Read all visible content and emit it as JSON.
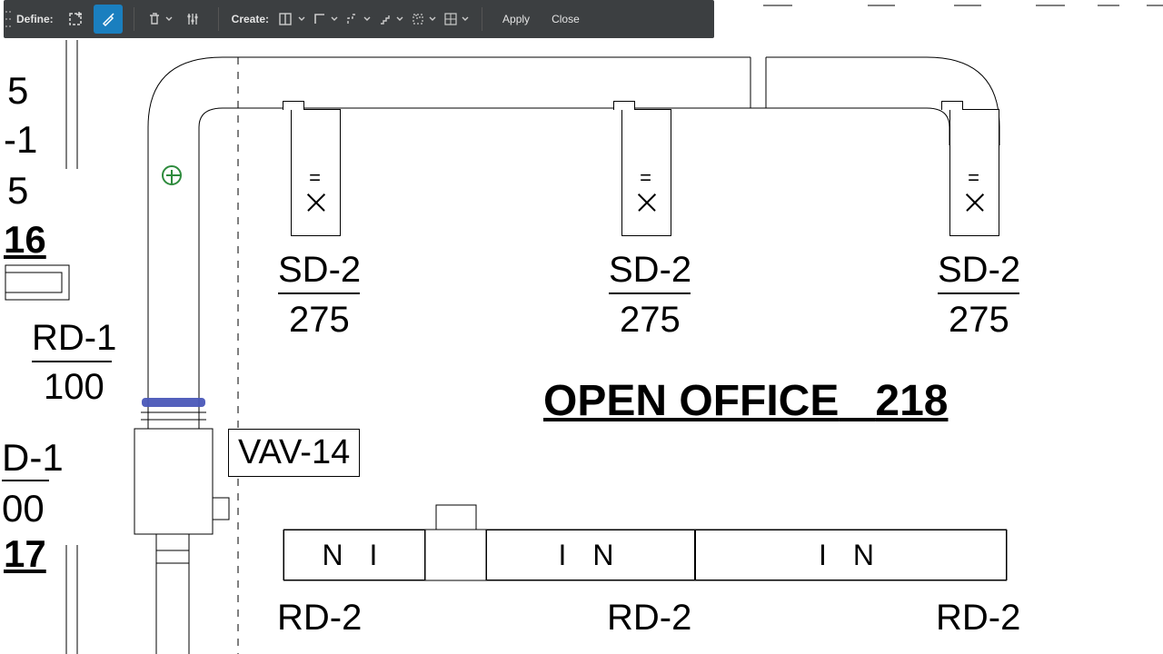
{
  "toolbar": {
    "define_label": "Define:",
    "create_label": "Create:",
    "apply_label": "Apply",
    "close_label": "Close"
  },
  "room": {
    "name": "OPEN OFFICE",
    "number": "218"
  },
  "vav": {
    "label": "VAV-14"
  },
  "sd": [
    {
      "tag": "SD-2",
      "cfm": "275"
    },
    {
      "tag": "SD-2",
      "cfm": "275"
    },
    {
      "tag": "SD-2",
      "cfm": "275"
    }
  ],
  "rd_left": {
    "tag": "RD-1",
    "cfm": "100"
  },
  "rd_bottom": [
    {
      "tag": "RD-2",
      "glyph": "N   I"
    },
    {
      "tag": "RD-2",
      "glyph": "I   N"
    },
    {
      "tag": "RD-2",
      "glyph": "I   N"
    }
  ],
  "edge": {
    "n5a": "5",
    "n_neg1": "-1",
    "n5b": "5",
    "n16": "16",
    "d1": "D-1",
    "d1_cfm": "00",
    "n17": "17"
  }
}
